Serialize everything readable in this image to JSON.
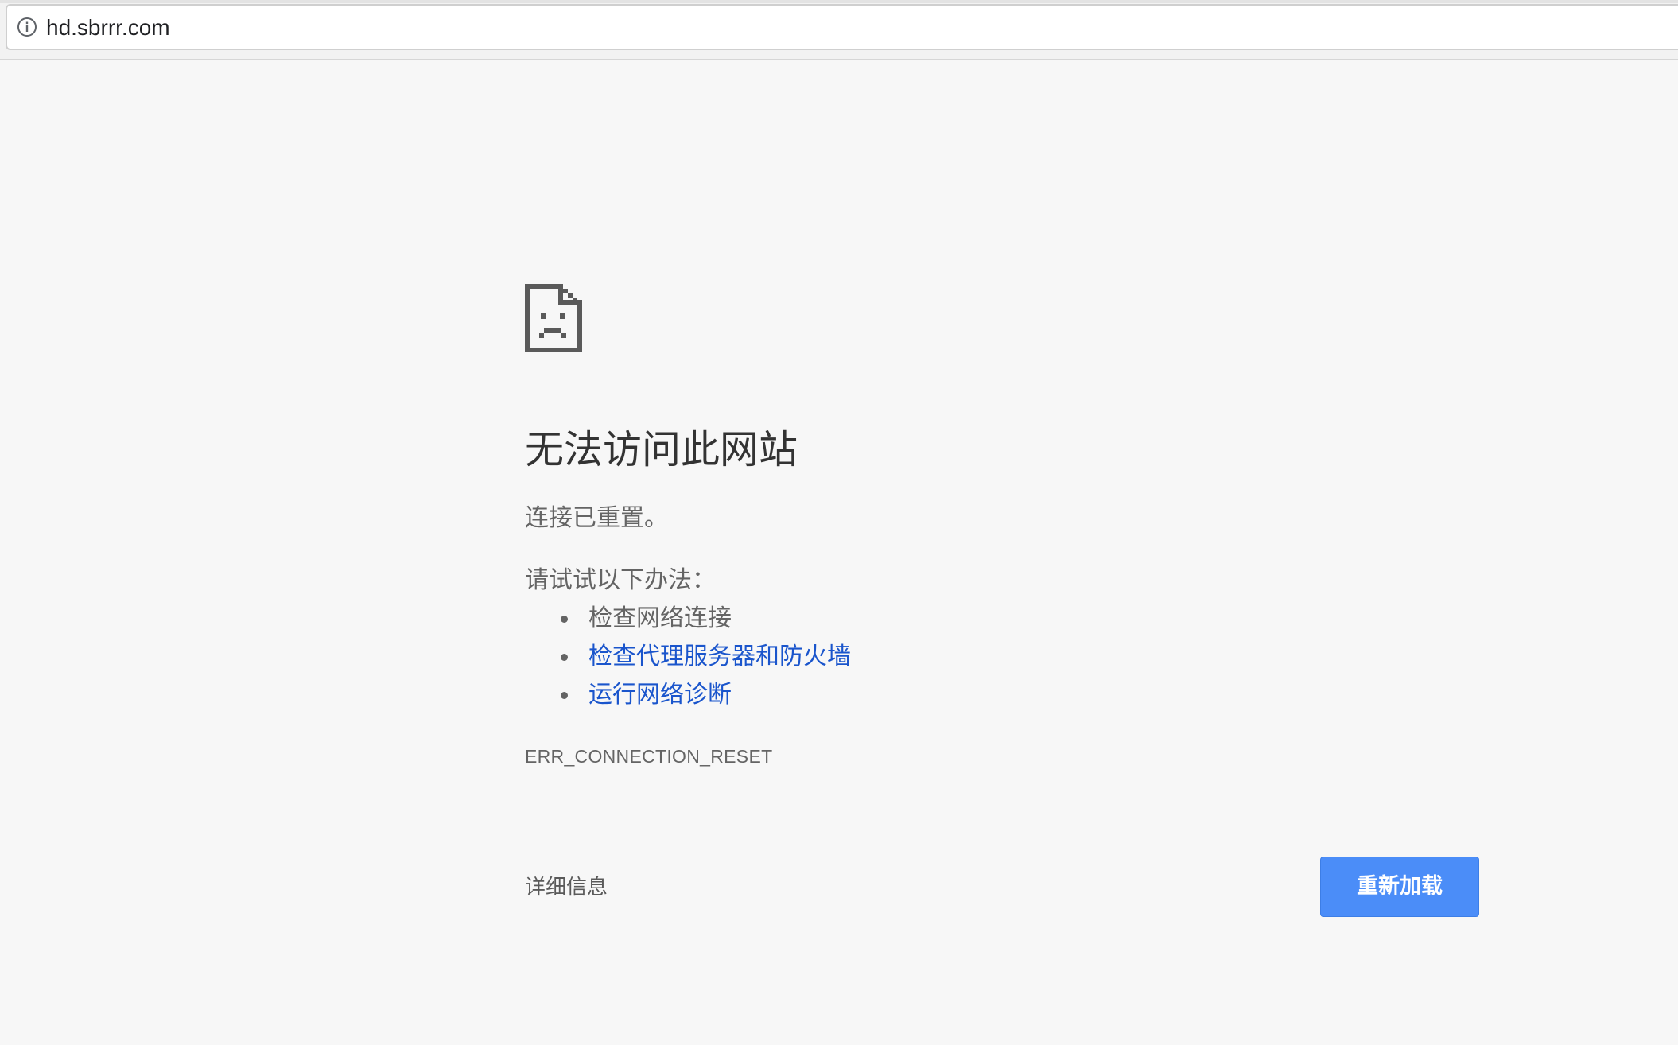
{
  "browser": {
    "url": "hd.sbrrr.com",
    "site_info_icon": "info-circle-icon"
  },
  "error_page": {
    "icon": "sad-document-icon",
    "title": "无法访问此网站",
    "subtitle": "连接已重置。",
    "suggestions_heading": "请试试以下办法：",
    "suggestions": [
      {
        "label": "检查网络连接",
        "is_link": false
      },
      {
        "label": "检查代理服务器和防火墙",
        "is_link": true
      },
      {
        "label": "运行网络诊断",
        "is_link": true
      }
    ],
    "error_code": "ERR_CONNECTION_RESET",
    "details_label": "详细信息",
    "reload_label": "重新加载"
  },
  "colors": {
    "page_background": "#f7f7f7",
    "link": "#1a55cc",
    "reload_button": "#4b8df8",
    "text_primary": "#333333",
    "text_secondary": "#646464"
  }
}
